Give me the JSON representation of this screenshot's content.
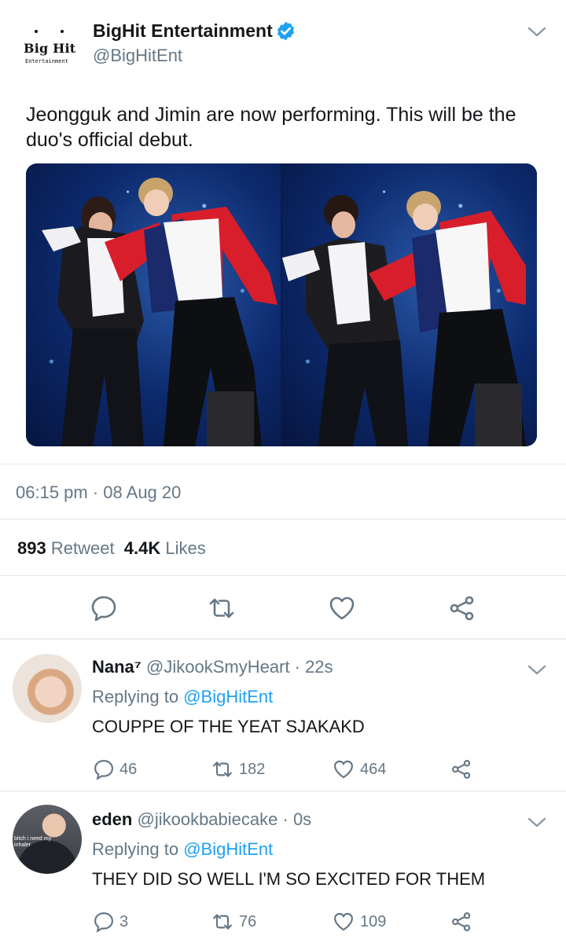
{
  "tweet": {
    "logo_text": "Big Hit",
    "logo_subtext": "Entertainment",
    "author_name": "BigHit Entertainment",
    "author_handle": "@BigHitEnt",
    "text": "Jeongguk and Jimin are now performing. This will be the duo's official debut.",
    "timestamp": "06:15 pm · 08 Aug 20",
    "retweet_count": "893",
    "retweet_label": "Retweet",
    "likes_count": "4.4K",
    "likes_label": "Likes"
  },
  "icons": {
    "verified": "verified-badge-icon",
    "reply": "reply-icon",
    "retweet": "retweet-icon",
    "like": "heart-icon",
    "share": "share-icon",
    "caret": "chevron-down-icon"
  },
  "colors": {
    "accent": "#1da1f2",
    "muted": "#657786",
    "text": "#14171a",
    "divider": "#e1e8ed"
  },
  "replies": [
    {
      "name": "Nana⁷",
      "handle": "@JikookSmyHeart",
      "time": "· 22s",
      "replying_prefix": "Replying to",
      "replying_to": "@BigHitEnt",
      "text": "COUPPE OF THE YEAT SJAKAKD",
      "reply_count": "46",
      "retweet_count": "182",
      "like_count": "464"
    },
    {
      "name": "eden",
      "handle": "@jikookbabiecake",
      "time": "· 0s",
      "replying_prefix": "Replying to",
      "replying_to": "@BigHitEnt",
      "text": "THEY DID SO WELL I'M SO EXCITED FOR THEM",
      "avatar_caption": "bitch i need my inhaler",
      "reply_count": "3",
      "retweet_count": "76",
      "like_count": "109"
    }
  ]
}
